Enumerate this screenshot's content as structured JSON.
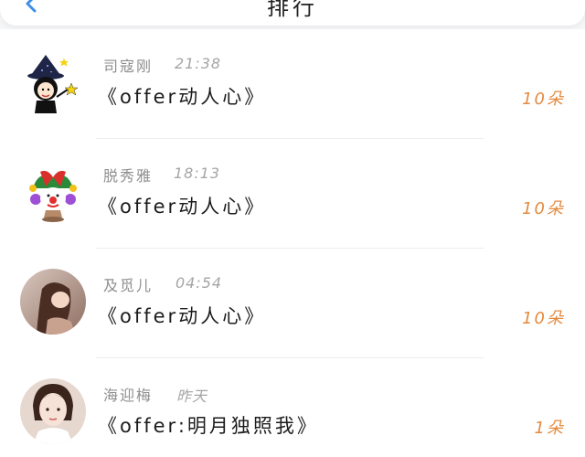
{
  "header": {
    "title": "排行"
  },
  "list": {
    "items": [
      {
        "name": "司寇刚",
        "time": "21:38",
        "title": "《offer动人心》",
        "amount": "10朵",
        "avatar_icon": "witch-avatar-icon"
      },
      {
        "name": "脱秀雅",
        "time": "18:13",
        "title": "《offer动人心》",
        "amount": "10朵",
        "avatar_icon": "clown-avatar-icon"
      },
      {
        "name": "及觅儿",
        "time": "04:54",
        "title": "《offer动人心》",
        "amount": "10朵",
        "avatar_icon": "photo-avatar-icon"
      },
      {
        "name": "海迎梅",
        "time": "昨天",
        "title": "《offer:明月独照我》",
        "amount": "1朵",
        "avatar_icon": "photo-avatar-icon"
      }
    ]
  },
  "colors": {
    "accent": "#e48a3f",
    "back_arrow": "#3d8fe8",
    "background": "#f4f5f7"
  }
}
